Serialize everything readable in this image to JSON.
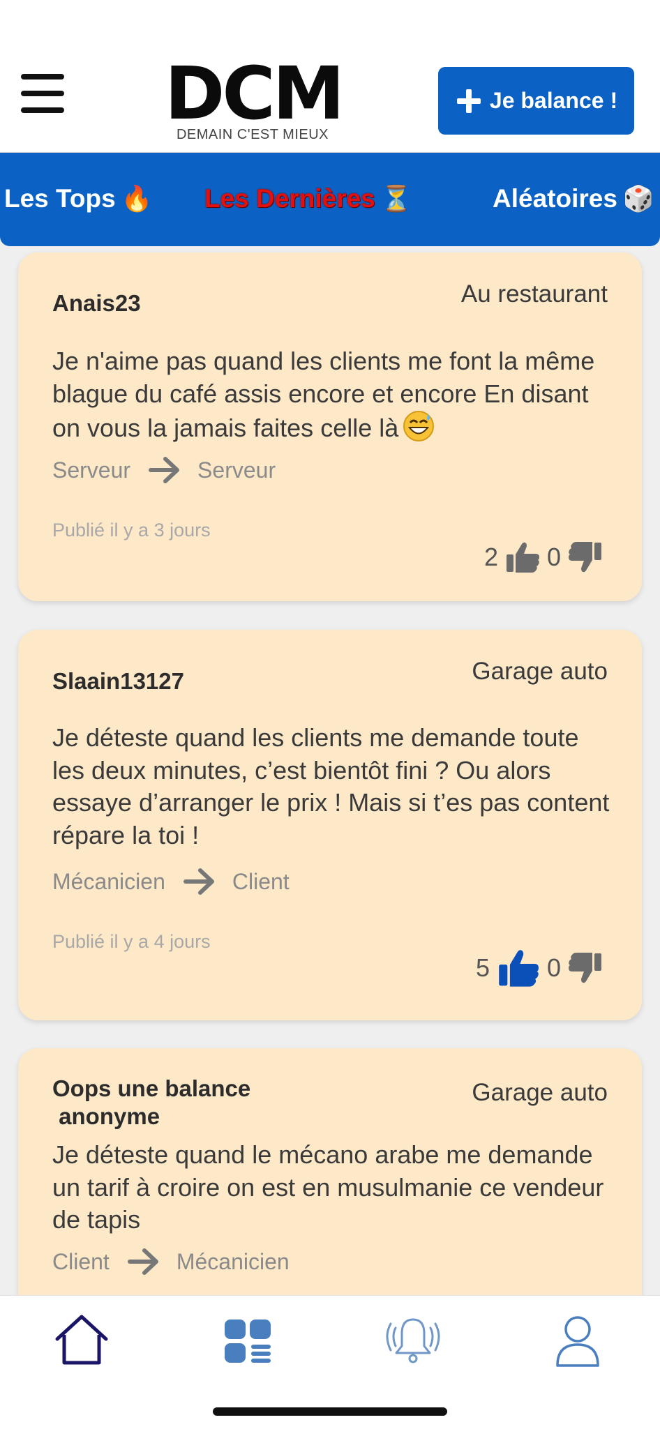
{
  "header": {
    "logo_text": "DCM",
    "logo_tagline": "DEMAIN C'EST MIEUX",
    "cta_label": "Je balance !"
  },
  "tabs": [
    {
      "label": "Les Tops",
      "emoji": "🔥",
      "active": false
    },
    {
      "label": "Les Dernières",
      "emoji": "⏳",
      "active": true
    },
    {
      "label": "Aléatoires",
      "emoji": "🎲",
      "active": false
    }
  ],
  "posts": [
    {
      "author": "Anais23",
      "category": "Au restaurant",
      "text": "Je n'aime pas quand les clients me font la même blague du café assis encore et encore En disant on vous la jamais faites celle là",
      "emoji": "😅",
      "from_role": "Serveur",
      "to_role": "Serveur",
      "published": "Publié il y a 3 jours",
      "likes": "2",
      "dislikes": "0",
      "liked": false
    },
    {
      "author": "Slaain13127",
      "category": "Garage auto",
      "text": "Je déteste quand les clients me demande toute les deux minutes, c’est bientôt fini ? Ou alors essaye d’arranger le prix ! Mais si t’es pas content répare la toi !",
      "from_role": "Mécanicien",
      "to_role": "Client",
      "published": "Publié il y a 4 jours",
      "likes": "5",
      "dislikes": "0",
      "liked": true
    },
    {
      "author": "Oops une balance\n anonyme",
      "category": "Garage auto",
      "text": "Je déteste quand le mécano arabe me demande un tarif à croire on est en musulmanie ce vendeur de tapis",
      "from_role": "Client",
      "to_role": "Mécanicien"
    }
  ],
  "colors": {
    "brand_blue": "#0b62c4",
    "card_bg": "#fde8c8",
    "active_tab": "#e11111",
    "liked_thumb": "#0b4fb8",
    "neutral_thumb": "#6b6b6b"
  },
  "icons": {
    "menu": "hamburger-icon",
    "cta": "plus-icon",
    "arrow": "arrow-right-icon",
    "like": "thumbs-up-icon",
    "dislike": "thumbs-down-icon",
    "nav": [
      "home-icon",
      "grid-list-icon",
      "bell-ringing-icon",
      "user-icon"
    ]
  }
}
